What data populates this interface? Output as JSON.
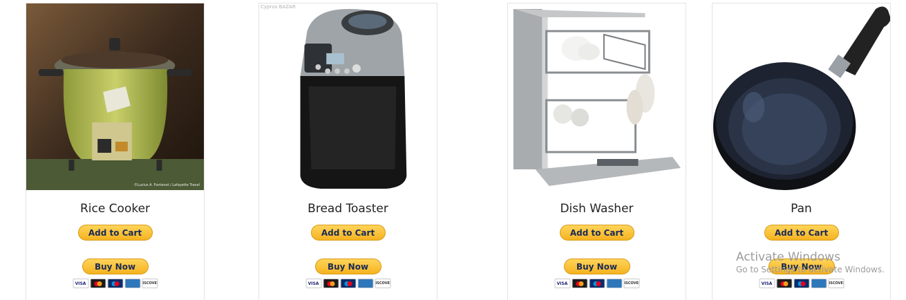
{
  "products": [
    {
      "name": "Rice Cooker",
      "add_label": "Add to Cart",
      "buy_label": "Buy Now",
      "photo_credit": "©Lucius A. Fontenot / Lafayette Travel"
    },
    {
      "name": "Bread Toaster",
      "add_label": "Add to Cart",
      "buy_label": "Buy Now",
      "watermark_logo": "Cyprus BAZAR"
    },
    {
      "name": "Dish Washer",
      "add_label": "Add to Cart",
      "buy_label": "Buy Now"
    },
    {
      "name": "Pan",
      "add_label": "Add to Cart",
      "buy_label": "Buy Now"
    }
  ],
  "payment_cards": [
    "VISA",
    "MasterCard",
    "Maestro",
    "American Express",
    "DISCOVER"
  ],
  "os_watermark": {
    "line1": "Activate Windows",
    "line2": "Go to Settings to activate Windows."
  },
  "colors": {
    "button_gold": "#f5b320",
    "button_text": "#1a2a55",
    "card_border": "#e3e3e3"
  }
}
